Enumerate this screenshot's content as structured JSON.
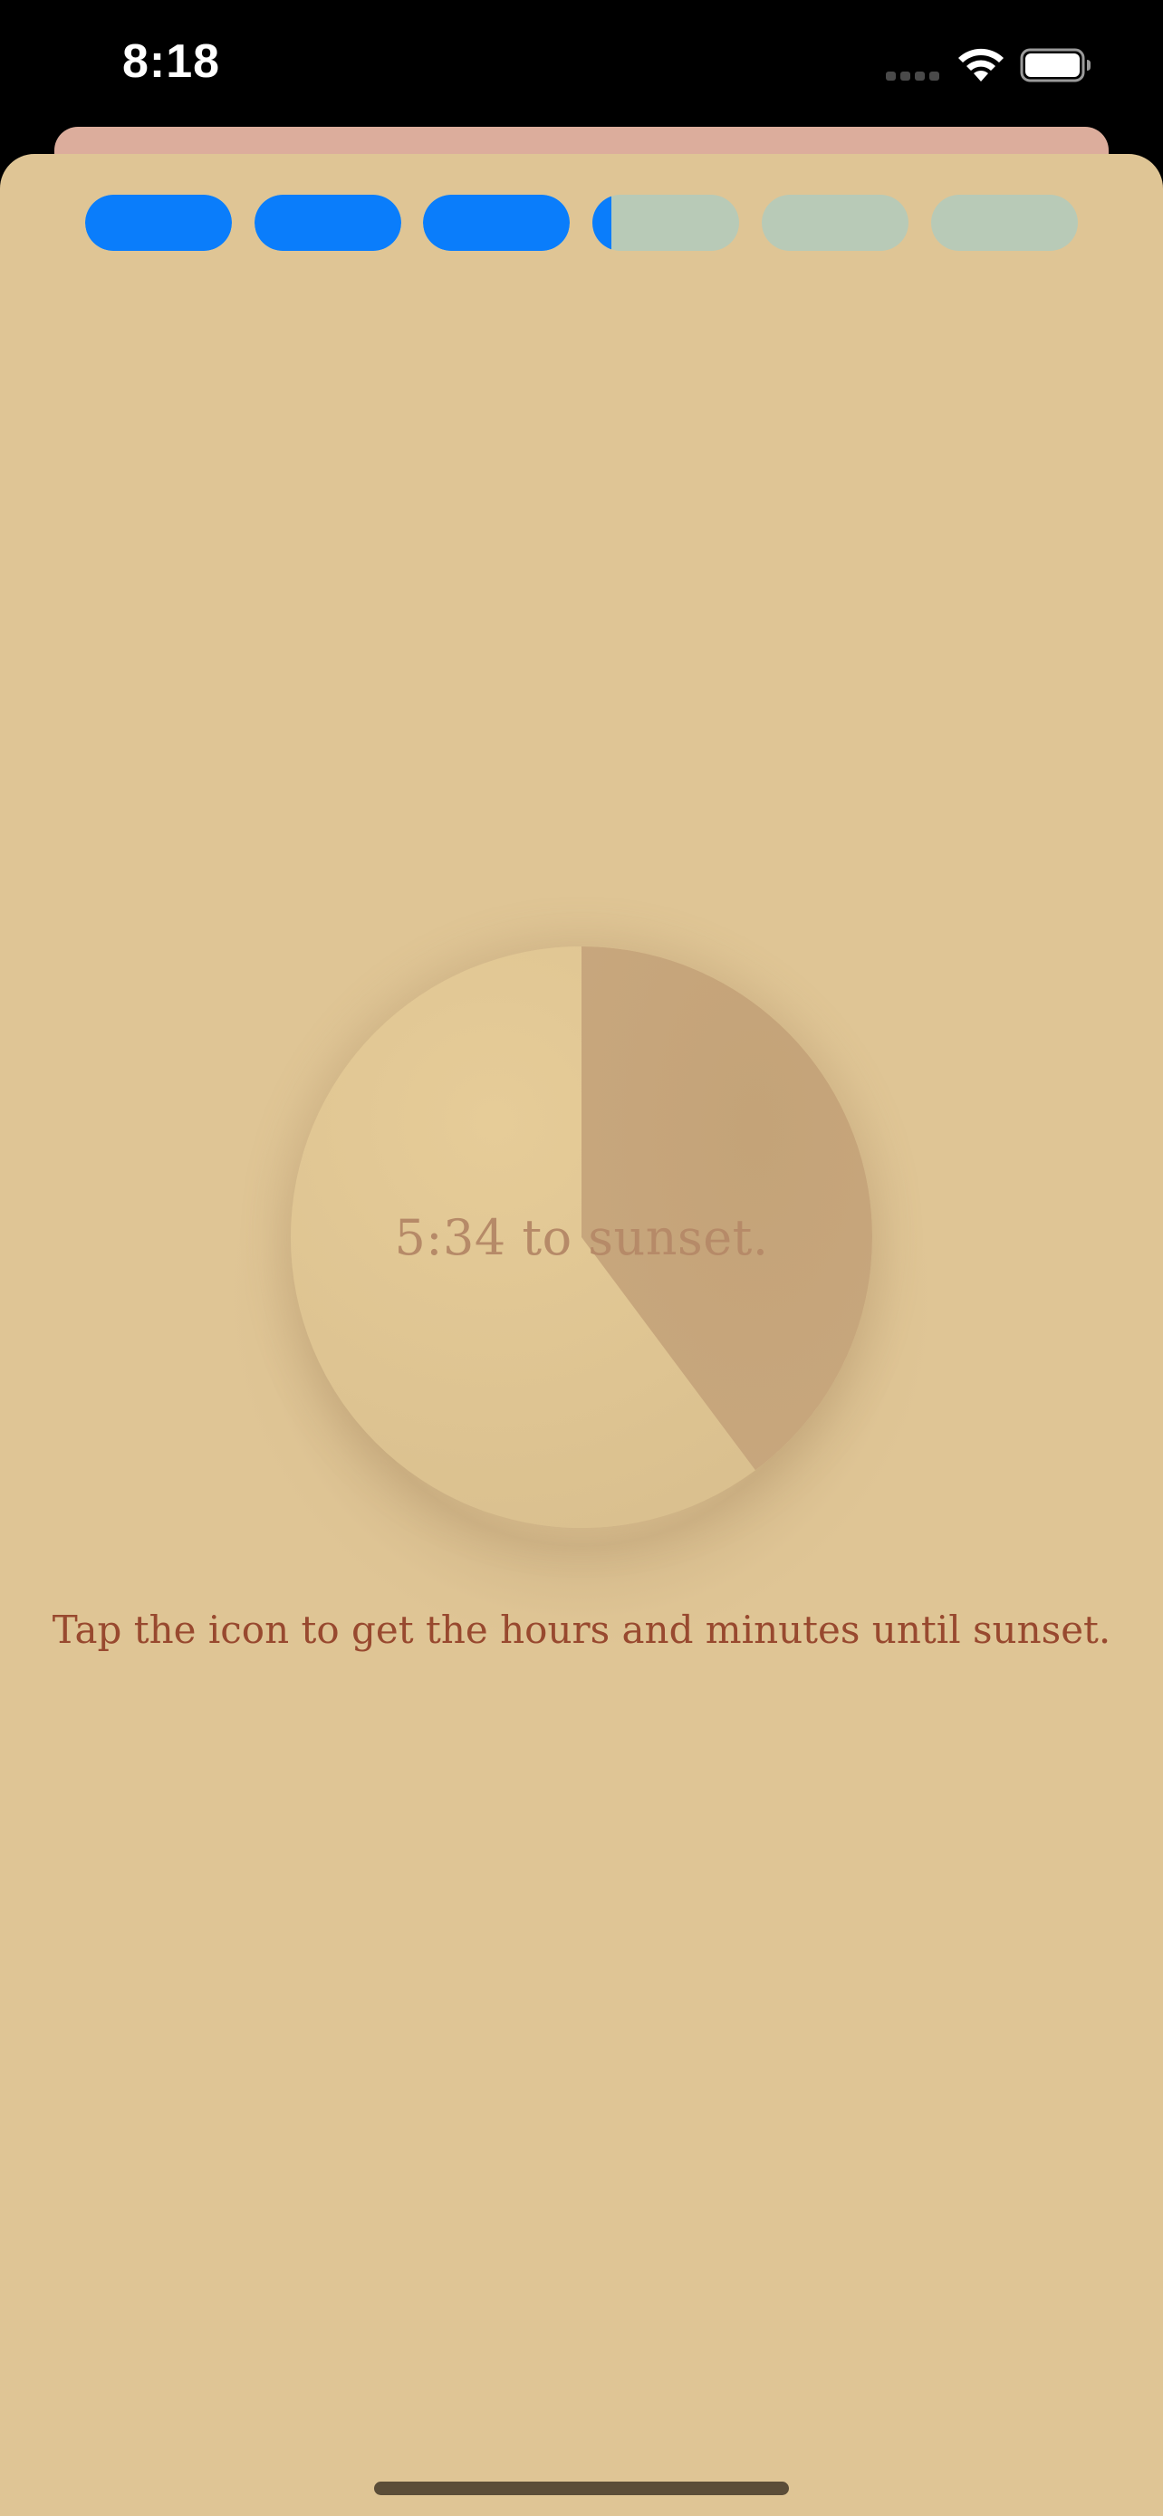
{
  "status_bar": {
    "time": "8:18",
    "signal_icon": "cellular-signal-icon",
    "wifi_icon": "wifi-icon",
    "battery_icon": "battery-icon",
    "battery_level": 1.0
  },
  "progress": {
    "segments": [
      {
        "fill": 1.0
      },
      {
        "fill": 1.0
      },
      {
        "fill": 1.0
      },
      {
        "fill": 0.13
      },
      {
        "fill": 0.0
      },
      {
        "fill": 0.0
      }
    ],
    "active_color": "#0a7dfb",
    "inactive_color": "#b8cab7"
  },
  "sunset_clock": {
    "label": "5:34 to sunset.",
    "remaining_fraction": 0.398,
    "remaining_color": "#c6a57c",
    "elapsed_color": "#e0c893"
  },
  "caption": "Tap the icon to get the hours and minutes until sunset.",
  "colors": {
    "sheet_background": "#dfc595",
    "back_card": "#dcad9c",
    "caption_text": "#98492f",
    "clock_text": "#b68a68"
  }
}
